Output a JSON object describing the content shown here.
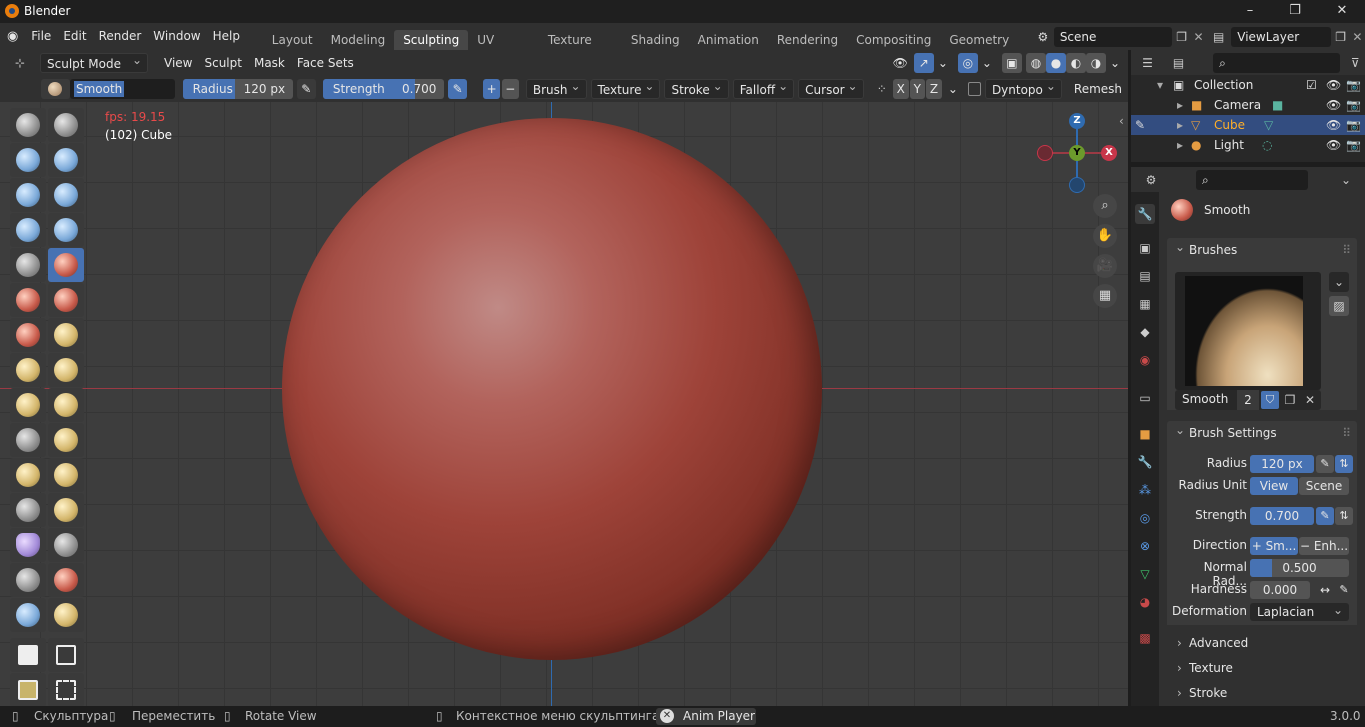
{
  "window": {
    "title": "Blender",
    "minimize_icon": "–",
    "restore_icon": "❐",
    "close_icon": "✕"
  },
  "menu": {
    "items": [
      "File",
      "Edit",
      "Render",
      "Window",
      "Help"
    ],
    "workspaces": [
      "Layout",
      "Modeling",
      "Sculpting",
      "UV Editing",
      "Texture Paint",
      "Shading",
      "Animation",
      "Rendering",
      "Compositing",
      "Geometry Nod"
    ],
    "active_workspace": "Sculpting",
    "scene": "Scene",
    "view_layer": "ViewLayer"
  },
  "header": {
    "mode": "Sculpt Mode",
    "menus": [
      "View",
      "Sculpt",
      "Mask",
      "Face Sets"
    ]
  },
  "tool_settings": {
    "brush_name": "Smooth",
    "radius_label": "Radius",
    "radius_value": "120 px",
    "strength_label": "Strength",
    "strength_value": "0.700",
    "strength_fraction": 0.7,
    "plus": "+",
    "minus": "−",
    "dropdowns": [
      "Brush",
      "Texture",
      "Stroke",
      "Falloff",
      "Cursor"
    ],
    "axes": [
      "X",
      "Y",
      "Z"
    ],
    "dyntopo": "Dyntopo",
    "remesh": "Remesh"
  },
  "viewport": {
    "fps": "fps: 19.15",
    "object_info": "(102) Cube",
    "gizmo": {
      "x": "X",
      "y": "Y",
      "z": "Z"
    }
  },
  "outliner": {
    "collection": "Collection",
    "items": [
      {
        "name": "Camera",
        "selected": false
      },
      {
        "name": "Cube",
        "selected": true
      },
      {
        "name": "Light",
        "selected": false
      }
    ]
  },
  "properties": {
    "active_brush": "Smooth",
    "brushes_panel": "Brushes",
    "brush_slot_name": "Smooth",
    "brush_users": "2",
    "brush_settings_panel": "Brush Settings",
    "radius_label": "Radius",
    "radius_value": "120 px",
    "radius_unit_label": "Radius Unit",
    "radius_unit_view": "View",
    "radius_unit_scene": "Scene",
    "strength_label": "Strength",
    "strength_value": "0.700",
    "direction_label": "Direction",
    "direction_smooth": "Sm...",
    "direction_enhance": "Enh...",
    "normal_radius_label": "Normal Rad...",
    "normal_radius_value": "0.500",
    "hardness_label": "Hardness",
    "hardness_value": "0.000",
    "deformation_label": "Deformation",
    "deformation_value": "Laplacian",
    "subpanels": [
      "Advanced",
      "Texture",
      "Stroke"
    ]
  },
  "status": {
    "left": "Скульптура",
    "move": "Переместить",
    "rotate": "Rotate View",
    "context": "Контекстное меню скульптинга",
    "anim_player": "Anim Player",
    "version": "3.0.0"
  }
}
